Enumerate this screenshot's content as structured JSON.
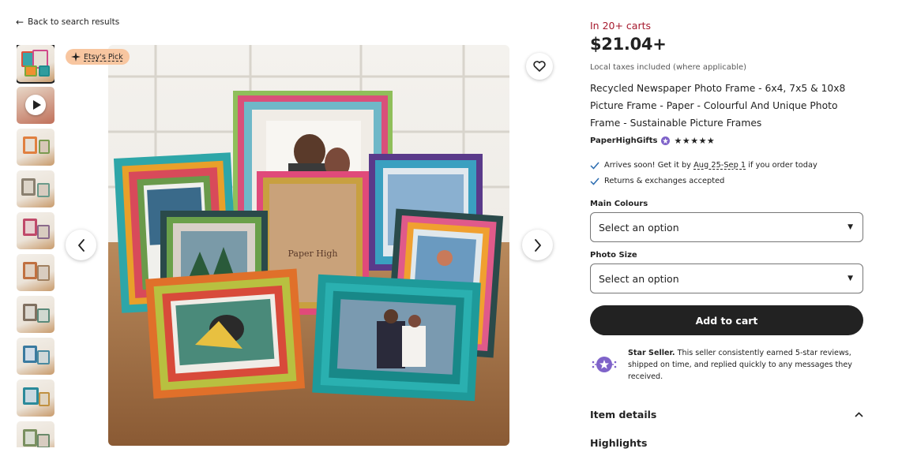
{
  "nav": {
    "back_label": "Back to search results"
  },
  "gallery": {
    "badge_label": "Etsy's Pick",
    "thumbnail_count": 10
  },
  "product": {
    "in_carts": "In 20+ carts",
    "price": "$21.04+",
    "taxes_note": "Local taxes included (where applicable)",
    "title": "Recycled Newspaper Photo Frame - 6x4, 7x5 & 10x8 Picture Frame - Paper - Colourful And Unique Photo Frame - Sustainable Picture Frames",
    "shop_name": "PaperHighGifts",
    "rating_stars": "★★★★★",
    "frame_label": "Paper High"
  },
  "shipping": {
    "arrives_prefix": "Arrives soon! Get it by",
    "arrives_dates": "Aug 25-Sep 1",
    "arrives_suffix": "if you order today",
    "returns": "Returns & exchanges accepted"
  },
  "options": {
    "colour_label": "Main Colours",
    "colour_value": "Select an option",
    "size_label": "Photo Size",
    "size_value": "Select an option"
  },
  "cart": {
    "button_label": "Add to cart"
  },
  "star_seller": {
    "title": "Star Seller.",
    "text": "This seller consistently earned 5-star reviews, shipped on time, and replied quickly to any messages they received."
  },
  "sections": {
    "item_details": "Item details",
    "highlights": "Highlights"
  },
  "colors": {
    "accent_red": "#a61a2e",
    "button_dark": "#222222",
    "badge_peach": "#f8c6a0",
    "star_seller_purple": "#7f63c9"
  }
}
